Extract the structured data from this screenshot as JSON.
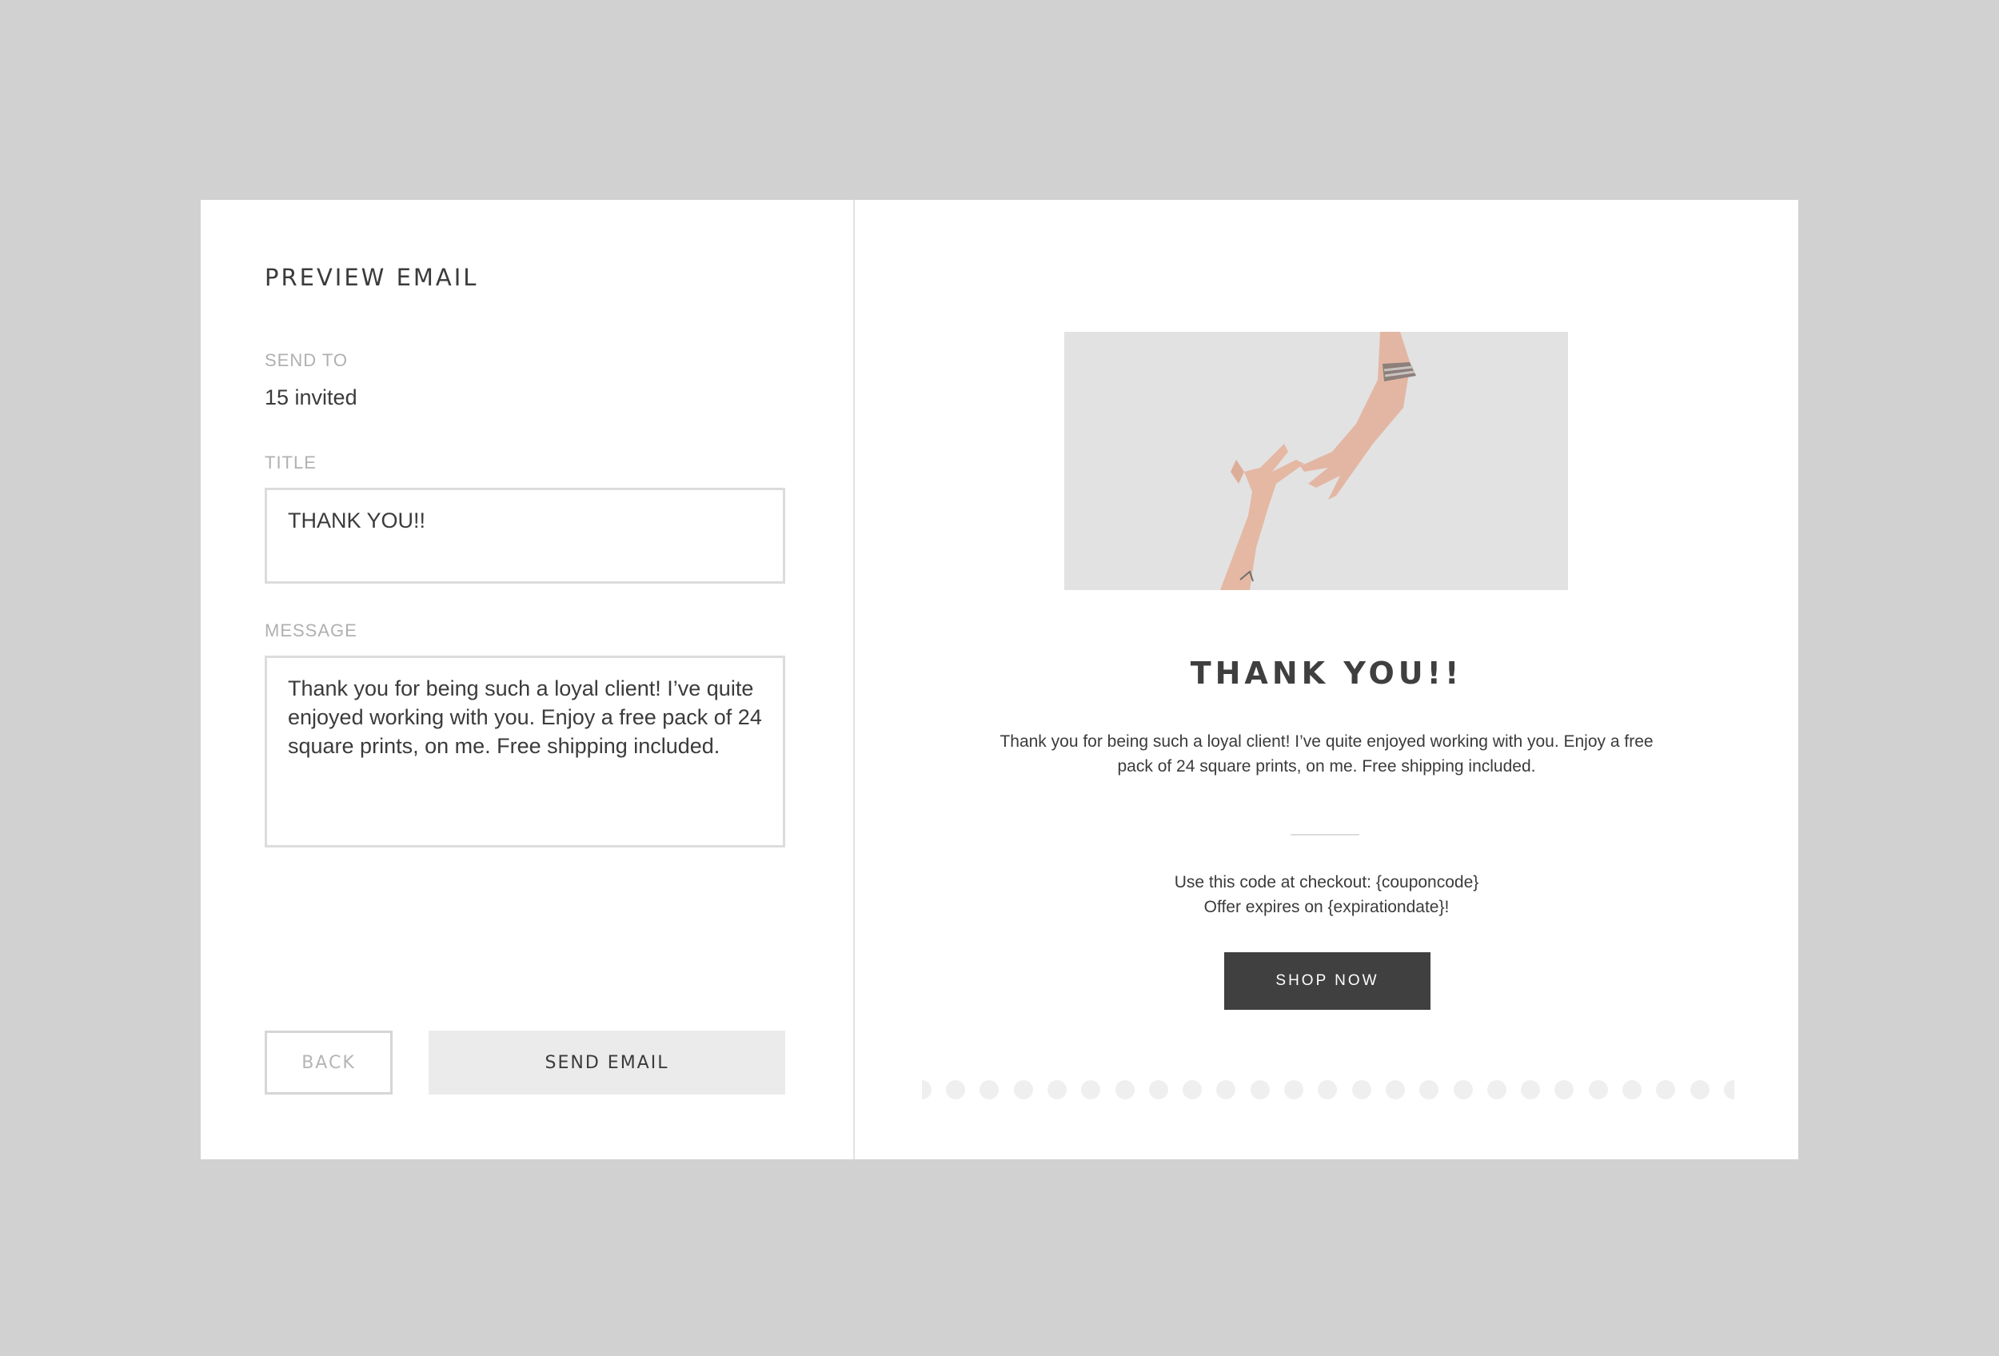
{
  "left": {
    "heading": "PREVIEW EMAIL",
    "send_to": {
      "label": "SEND TO",
      "value": "15 invited"
    },
    "title_field": {
      "label": "TITLE",
      "value": "THANK YOU!!"
    },
    "message_field": {
      "label": "MESSAGE",
      "value": "Thank you for being such a loyal client! I’ve quite enjoyed working with you. Enjoy a free pack of 24 square prints, on me. Free shipping included."
    },
    "buttons": {
      "back": "BACK",
      "send": "SEND EMAIL"
    }
  },
  "preview": {
    "image": "hands-reaching-photo",
    "title": "THANK YOU!!",
    "body": "Thank you for being such a loyal client! I’ve quite enjoyed working with you. Enjoy a free pack of 24 square prints, on me. Free shipping included.",
    "coupon_line": "Use this code at checkout: {couponcode}",
    "expiry_line": "Offer expires on {expirationdate}!",
    "cta": "SHOP NOW"
  },
  "colors": {
    "page_background": "#d1d1d1",
    "card_background": "#ffffff",
    "primary_button": "#404040",
    "secondary_button": "#ebebeb",
    "label_gray": "#b0b0b0"
  }
}
